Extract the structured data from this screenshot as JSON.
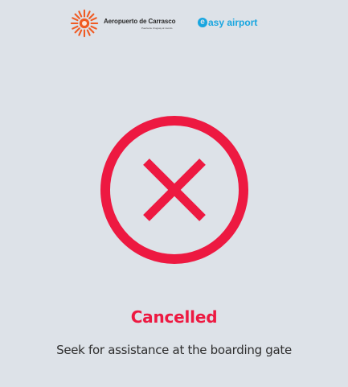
{
  "header": {
    "airport_name": "Aeropuerto de Carrasco",
    "airport_tagline": "Puerta de Uruguay al mundo",
    "partner_name": "asy airport",
    "partner_initial": "e"
  },
  "status": {
    "icon": "cancel-x-icon",
    "title": "Cancelled",
    "message": "Seek for assistance at the boarding gate"
  },
  "colors": {
    "background": "#dde2e8",
    "status_red": "#ed1941",
    "brand_orange": "#f05a22",
    "brand_blue": "#18a6e0",
    "text_dark": "#2e2e2e"
  }
}
